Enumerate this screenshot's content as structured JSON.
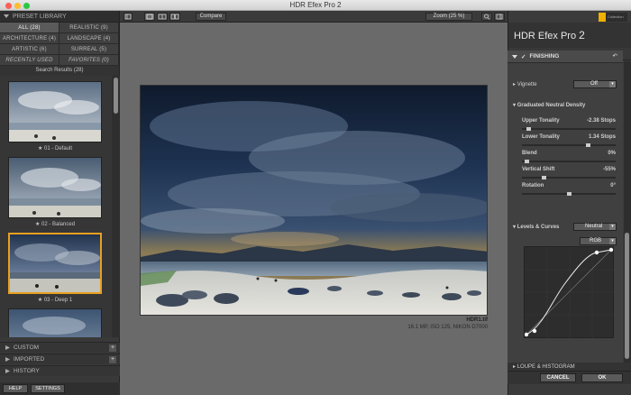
{
  "window": {
    "title": "HDR Efex Pro 2"
  },
  "library": {
    "header": "PRESET LIBRARY",
    "categories": [
      {
        "label": "ALL (28)"
      },
      {
        "label": "REALISTIC (9)"
      },
      {
        "label": "ARCHITECTURE (4)"
      },
      {
        "label": "LANDSCAPE (4)"
      },
      {
        "label": "ARTISTIC (6)"
      },
      {
        "label": "SURREAL (5)"
      },
      {
        "label": "RECENTLY USED"
      },
      {
        "label": "FAVORITES (0)"
      }
    ],
    "search_results": "Search Results (28)",
    "presets": [
      {
        "label": "01 - Default"
      },
      {
        "label": "02 - Balanced"
      },
      {
        "label": "03 - Deep 1"
      }
    ],
    "sections": [
      {
        "label": "CUSTOM"
      },
      {
        "label": "IMPORTED"
      },
      {
        "label": "HISTORY"
      }
    ],
    "help_label": "HELP",
    "settings_label": "SETTINGS"
  },
  "toolbar": {
    "compare_label": "Compare",
    "zoom_label": "Zoom (25 %)"
  },
  "photo": {
    "filename": "HDR1.tif",
    "meta": "16.1 MP, ISO 125, NIKON D7000"
  },
  "panel": {
    "product_name": "HDR Efex Pro",
    "product_version": "2",
    "finishing": "FINISHING",
    "vignette": {
      "label": "Vignette",
      "value": "Off"
    },
    "gnd": {
      "title": "Graduated Neutral Density",
      "upper": {
        "label": "Upper Tonality",
        "value": "-2.38  Stops",
        "level": 0.05
      },
      "lower": {
        "label": "Lower Tonality",
        "value": "1.34  Stops",
        "level": 0.72
      },
      "blend": {
        "label": "Blend",
        "value": "0%",
        "level": 0.03
      },
      "shift": {
        "label": "Vertical Shift",
        "value": "-55%",
        "level": 0.22
      },
      "rotation": {
        "label": "Rotation",
        "value": "0°",
        "level": 0.5
      }
    },
    "levels": {
      "label": "Levels & Curves",
      "preset": "Neutral",
      "channel": "RGB"
    },
    "loupe": "LOUPE & HISTOGRAM",
    "cancel_label": "CANCEL",
    "ok_label": "OK"
  }
}
